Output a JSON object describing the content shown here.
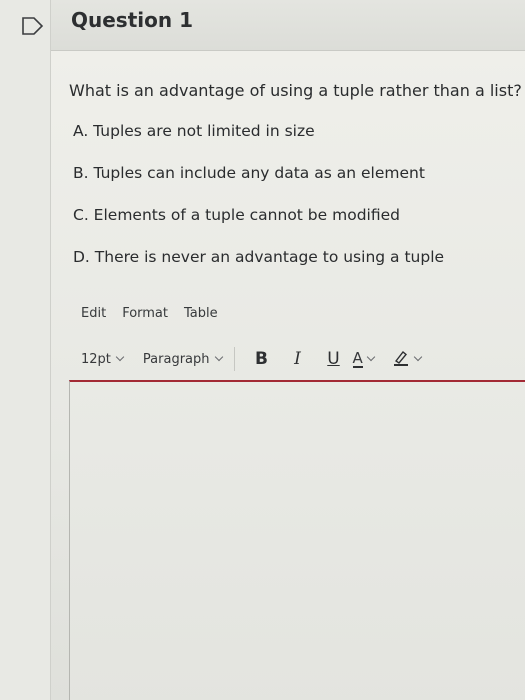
{
  "question": {
    "title": "Question 1",
    "prompt": "What is an advantage of using a tuple rather than a list?",
    "answers": [
      "A. Tuples are not limited in size",
      "B. Tuples can include any data as an element",
      "C. Elements of a tuple cannot be modified",
      "D. There is never an advantage to using a tuple"
    ]
  },
  "editor": {
    "menu": [
      "Edit",
      "Format",
      "Table"
    ],
    "font_size": "12pt",
    "block_format": "Paragraph",
    "bold": "B",
    "italic": "I",
    "underline": "U",
    "text_color": "A",
    "accent_color": "#a32a35"
  },
  "icons": {
    "flag": "flag-icon",
    "chevron": "chevron-down-icon",
    "highlighter": "highlighter-icon"
  }
}
